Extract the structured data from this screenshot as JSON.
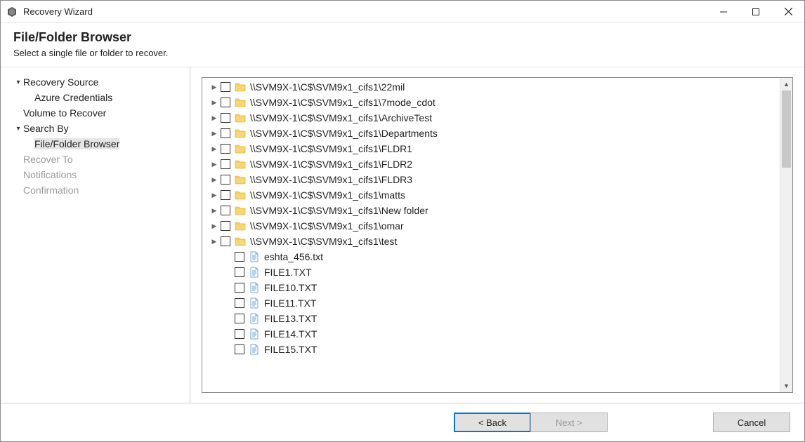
{
  "window": {
    "title": "Recovery Wizard"
  },
  "header": {
    "title": "File/Folder Browser",
    "subtitle": "Select a single file or folder to recover."
  },
  "sidebar": {
    "items": [
      {
        "label": "Recovery Source",
        "type": "group",
        "expanded": true,
        "enabled": true
      },
      {
        "label": "Azure Credentials",
        "type": "child",
        "enabled": true
      },
      {
        "label": "Volume to Recover",
        "type": "item",
        "enabled": true
      },
      {
        "label": "Search By",
        "type": "group",
        "expanded": true,
        "enabled": true
      },
      {
        "label": "File/Folder Browser",
        "type": "child",
        "enabled": true,
        "selected": true
      },
      {
        "label": "Recover To",
        "type": "item",
        "enabled": false
      },
      {
        "label": "Notifications",
        "type": "item",
        "enabled": false
      },
      {
        "label": "Confirmation",
        "type": "item",
        "enabled": false
      }
    ]
  },
  "tree": {
    "rows": [
      {
        "kind": "folder",
        "expandable": true,
        "path": "\\\\SVM9X-1\\C$\\SVM9x1_cifs1\\22mil"
      },
      {
        "kind": "folder",
        "expandable": true,
        "path": "\\\\SVM9X-1\\C$\\SVM9x1_cifs1\\7mode_cdot"
      },
      {
        "kind": "folder",
        "expandable": true,
        "path": "\\\\SVM9X-1\\C$\\SVM9x1_cifs1\\ArchiveTest"
      },
      {
        "kind": "folder",
        "expandable": true,
        "path": "\\\\SVM9X-1\\C$\\SVM9x1_cifs1\\Departments"
      },
      {
        "kind": "folder",
        "expandable": true,
        "path": "\\\\SVM9X-1\\C$\\SVM9x1_cifs1\\FLDR1"
      },
      {
        "kind": "folder",
        "expandable": true,
        "path": "\\\\SVM9X-1\\C$\\SVM9x1_cifs1\\FLDR2"
      },
      {
        "kind": "folder",
        "expandable": true,
        "path": "\\\\SVM9X-1\\C$\\SVM9x1_cifs1\\FLDR3"
      },
      {
        "kind": "folder",
        "expandable": true,
        "path": "\\\\SVM9X-1\\C$\\SVM9x1_cifs1\\matts"
      },
      {
        "kind": "folder",
        "expandable": true,
        "path": "\\\\SVM9X-1\\C$\\SVM9x1_cifs1\\New folder"
      },
      {
        "kind": "folder",
        "expandable": true,
        "path": "\\\\SVM9X-1\\C$\\SVM9x1_cifs1\\omar"
      },
      {
        "kind": "folder",
        "expandable": true,
        "path": "\\\\SVM9X-1\\C$\\SVM9x1_cifs1\\test"
      },
      {
        "kind": "file",
        "path": "eshta_456.txt"
      },
      {
        "kind": "file",
        "path": "FILE1.TXT"
      },
      {
        "kind": "file",
        "path": "FILE10.TXT"
      },
      {
        "kind": "file",
        "path": "FILE11.TXT"
      },
      {
        "kind": "file",
        "path": "FILE13.TXT"
      },
      {
        "kind": "file",
        "path": "FILE14.TXT"
      },
      {
        "kind": "file",
        "path": "FILE15.TXT"
      }
    ]
  },
  "footer": {
    "back": "< Back",
    "next": "Next >",
    "cancel": "Cancel"
  }
}
